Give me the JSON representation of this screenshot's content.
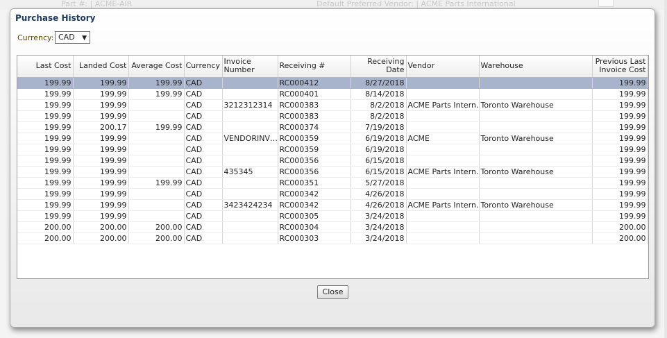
{
  "background": {
    "part_text": "Part #: | ACME-AIR",
    "vendor_text": "Default Preferred Vendor: | ACME Parts International"
  },
  "dialog": {
    "title": "Purchase History",
    "currency_label": "Currency:",
    "currency_value": "CAD",
    "close_label": "Close"
  },
  "table": {
    "headers": [
      "Last Cost",
      "Landed Cost",
      "Average Cost",
      "Currency",
      "Invoice Number",
      "Receiving #",
      "Receiving Date",
      "Vendor",
      "Warehouse",
      "Previous Last Invoice Cost"
    ],
    "rows": [
      [
        "199.99",
        "199.99",
        "199.99",
        "CAD",
        "",
        "RC000412",
        "8/27/2018",
        "",
        "",
        "199.99"
      ],
      [
        "199.99",
        "199.99",
        "199.99",
        "CAD",
        "",
        "RC000401",
        "8/14/2018",
        "",
        "",
        "199.99"
      ],
      [
        "199.99",
        "199.99",
        "",
        "CAD",
        "3212312314",
        "RC000383",
        "8/2/2018",
        "ACME Parts Intern…",
        "Toronto Warehouse",
        "199.99"
      ],
      [
        "199.99",
        "199.99",
        "",
        "CAD",
        "",
        "RC000383",
        "8/2/2018",
        "",
        "",
        "199.99"
      ],
      [
        "199.99",
        "200.17",
        "199.99",
        "CAD",
        "",
        "RC000374",
        "7/19/2018",
        "",
        "",
        "199.99"
      ],
      [
        "199.99",
        "199.99",
        "",
        "CAD",
        "VENDORINV…",
        "RC000359",
        "6/19/2018",
        "ACME",
        "Toronto Warehouse",
        "199.99"
      ],
      [
        "199.99",
        "199.99",
        "",
        "CAD",
        "",
        "RC000359",
        "6/19/2018",
        "",
        "",
        "199.99"
      ],
      [
        "199.99",
        "199.99",
        "",
        "CAD",
        "",
        "RC000356",
        "6/15/2018",
        "",
        "",
        "199.99"
      ],
      [
        "199.99",
        "199.99",
        "",
        "CAD",
        "435345",
        "RC000356",
        "6/15/2018",
        "ACME Parts Intern…",
        "Toronto Warehouse",
        "199.99"
      ],
      [
        "199.99",
        "199.99",
        "199.99",
        "CAD",
        "",
        "RC000351",
        "5/27/2018",
        "",
        "",
        "199.99"
      ],
      [
        "199.99",
        "199.99",
        "",
        "CAD",
        "",
        "RC000342",
        "4/26/2018",
        "",
        "",
        "199.99"
      ],
      [
        "199.99",
        "199.99",
        "",
        "CAD",
        "3423424234",
        "RC000342",
        "4/26/2018",
        "ACME Parts Intern…",
        "Toronto Warehouse",
        "199.99"
      ],
      [
        "199.99",
        "199.99",
        "",
        "CAD",
        "",
        "RC000305",
        "3/24/2018",
        "",
        "",
        "199.99"
      ],
      [
        "200.00",
        "200.00",
        "200.00",
        "CAD",
        "",
        "RC000304",
        "3/24/2018",
        "",
        "",
        "200.00"
      ],
      [
        "200.00",
        "200.00",
        "200.00",
        "CAD",
        "",
        "RC000303",
        "3/24/2018",
        "",
        "",
        "200.00"
      ]
    ],
    "selected_row": 0
  },
  "colors": {
    "selected_row": "#a8b4cc",
    "title": "#1d3a5c"
  }
}
